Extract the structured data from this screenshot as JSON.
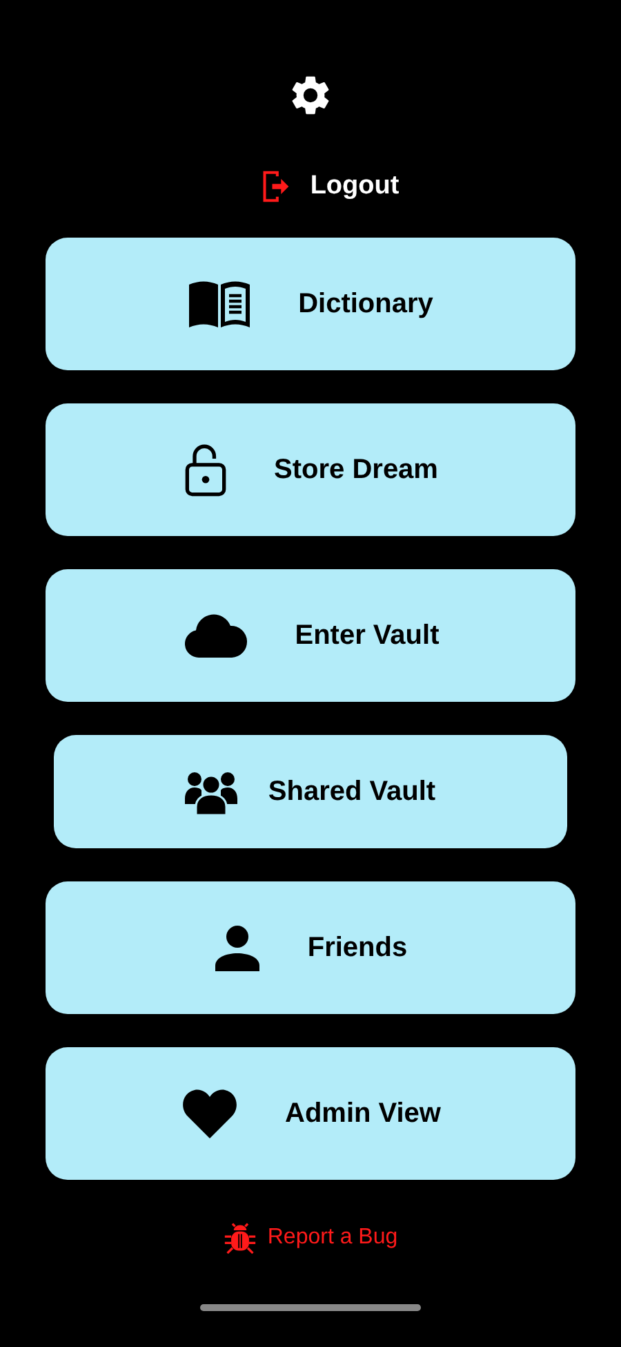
{
  "logout": {
    "label": "Logout"
  },
  "menu": [
    {
      "kind": "book",
      "label": "Dictionary",
      "compact": false
    },
    {
      "kind": "lock",
      "label": "Store Dream",
      "compact": false
    },
    {
      "kind": "cloud",
      "label": "Enter Vault",
      "compact": false
    },
    {
      "kind": "group",
      "label": "Shared Vault",
      "compact": true
    },
    {
      "kind": "person",
      "label": "Friends",
      "compact": false
    },
    {
      "kind": "heart",
      "label": "Admin View",
      "compact": false
    }
  ],
  "report": {
    "label": "Report a Bug"
  }
}
